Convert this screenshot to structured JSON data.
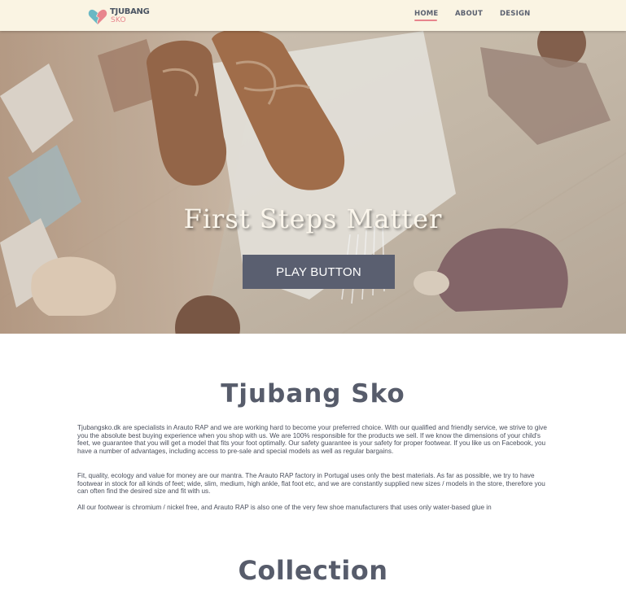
{
  "header": {
    "logo_line1": "TJUBANG",
    "logo_line2": "SKO",
    "nav": [
      {
        "label": "HOME",
        "active": true
      },
      {
        "label": "ABOUT",
        "active": false
      },
      {
        "label": "DESIGN",
        "active": false
      }
    ],
    "accent_color": "#e8858d"
  },
  "hero": {
    "title": "First Steps Matter",
    "button_label": "PLAY BUTTON"
  },
  "about": {
    "title": "Tjubang Sko",
    "paragraphs": [
      "Tjubangsko.dk are specialists in Arauto RAP and we are working hard to become your preferred choice. With our qualified and friendly service, we strive to give you the absolute best buying experience when you shop with us. We are 100% responsible for the products we sell. If we know the dimensions of your child's feet, we guarantee that you will get a model that fits your foot optimally. Our safety guarantee is your safety for proper footwear. If you like us on Facebook, you have a number of advantages, including access to pre-sale and special models as well as regular bargains.",
      "Fit, quality, ecology and value for money are our mantra. The Arauto RAP factory in Portugal uses only the best materials. As far as possible, we try to have footwear in stock for all kinds of feet; wide, slim, medium, high ankle, flat foot etc, and we are constantly supplied new sizes / models in the store, therefore you can often find the desired size and fit with us.",
      "All our footwear is chromium / nickel free, and Arauto RAP is also one of the very few shoe manufacturers that uses only water-based glue in"
    ]
  },
  "collection": {
    "title": "Collection"
  }
}
